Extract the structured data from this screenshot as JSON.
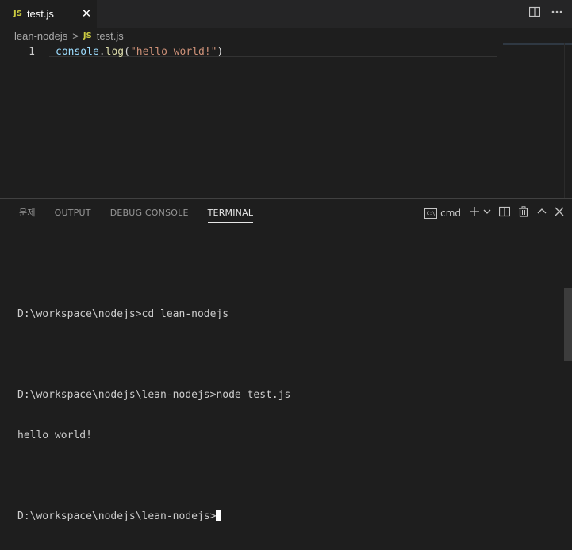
{
  "tab": {
    "icon_text": "JS",
    "label": "test.js",
    "close_glyph": "✕"
  },
  "tabbar_actions": {
    "split_editor_icon": "split-editor-icon",
    "more_actions_icon": "more-actions-icon"
  },
  "breadcrumb": {
    "folder": "lean-nodejs",
    "separator": ">",
    "file_icon_text": "JS",
    "file": "test.js"
  },
  "editor": {
    "line_number": "1",
    "tokens": {
      "obj": "console",
      "dot": ".",
      "fn": "log",
      "open": "(",
      "str": "\"hello world!\"",
      "close": ")"
    }
  },
  "panel": {
    "tabs": [
      "문제",
      "OUTPUT",
      "DEBUG CONSOLE",
      "TERMINAL"
    ],
    "active_tab": "TERMINAL",
    "cmd_label": "cmd"
  },
  "terminal": {
    "lines": [
      "",
      "D:\\workspace\\nodejs>cd lean-nodejs",
      "",
      "D:\\workspace\\nodejs\\lean-nodejs>node test.js",
      "hello world!",
      "",
      "D:\\workspace\\nodejs\\lean-nodejs>"
    ]
  },
  "colors": {
    "background": "#1e1e1e",
    "js_icon": "#cbcb41",
    "string": "#ce9178",
    "function": "#dcdcaa",
    "variable": "#9cdcfe"
  }
}
